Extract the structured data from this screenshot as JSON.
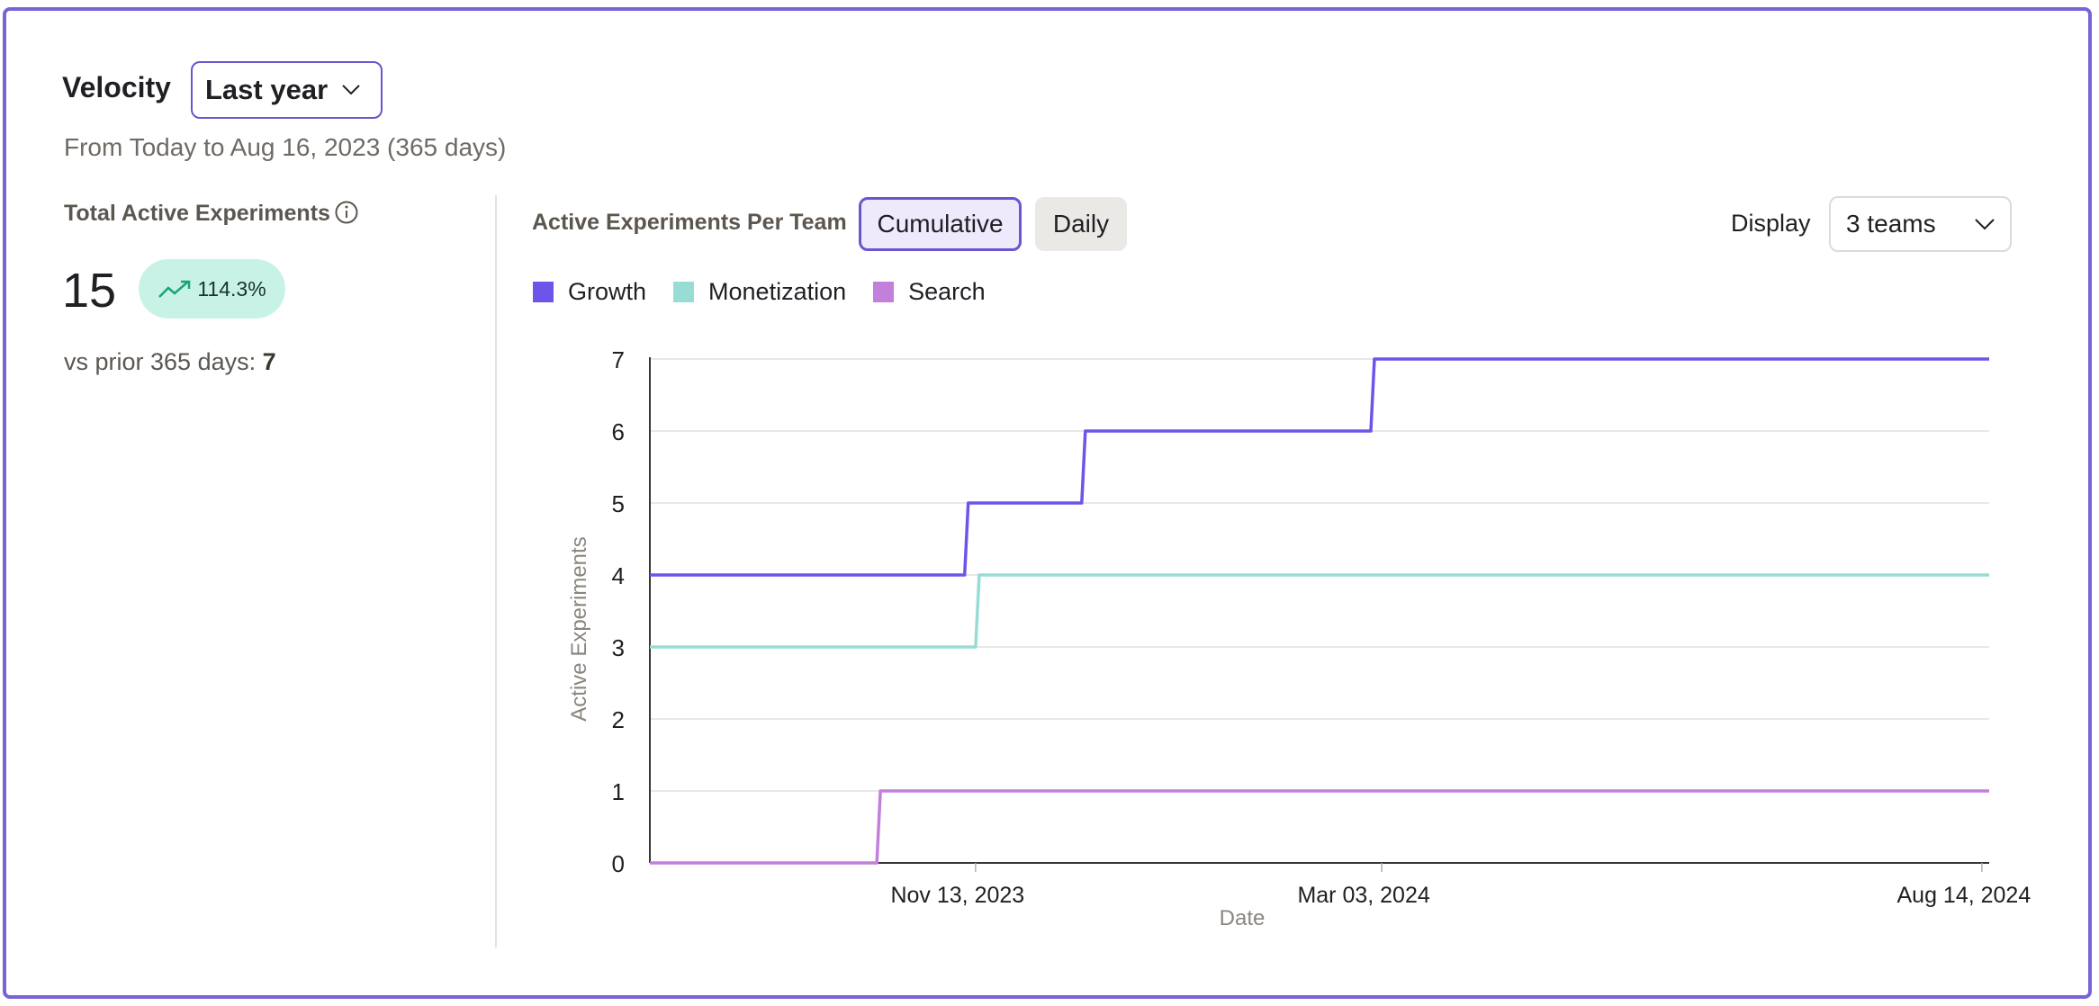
{
  "header": {
    "title": "Velocity",
    "range_select_value": "Last year",
    "range_subtitle": "From Today to Aug 16, 2023 (365 days)"
  },
  "summary": {
    "title": "Total Active Experiments",
    "value": "15",
    "delta": "114.3%",
    "vs_prior_label": "vs prior 365 days:",
    "vs_prior_value": "7"
  },
  "chart_panel": {
    "title": "Active Experiments Per Team",
    "toggle": [
      "Cumulative",
      "Daily"
    ],
    "toggle_selected": "Cumulative",
    "display_label": "Display",
    "display_value": "3 teams"
  },
  "colors": {
    "accent": "#6b55cf",
    "growth": "#6c55e8",
    "monetization": "#97ddd5",
    "search": "#c27fdc",
    "badge_bg": "#c9f2e6",
    "badge_icon": "#1aa37a"
  },
  "icons": {
    "range_chevron": "chevron-down-icon",
    "info": "info-icon",
    "trend": "trending-up-icon",
    "teams_chevron": "chevron-down-icon"
  },
  "chart_data": {
    "type": "line",
    "step": true,
    "xlabel": "Date",
    "ylabel": "Active Experiments",
    "ylim": [
      0,
      7
    ],
    "xlim": [
      "2023-08-16",
      "2024-08-16"
    ],
    "yticks": [
      0,
      1,
      2,
      3,
      4,
      5,
      6,
      7
    ],
    "xticks": [
      {
        "label": "Nov 13, 2023",
        "date": "2023-11-13"
      },
      {
        "label": "Mar 03, 2024",
        "date": "2024-03-03"
      },
      {
        "label": "Aug 14, 2024",
        "date": "2024-08-14"
      }
    ],
    "grid": true,
    "legend_position": "top-left",
    "series": [
      {
        "name": "Growth",
        "color": "#6c55e8",
        "points": [
          [
            "2023-08-16",
            4
          ],
          [
            "2023-11-11",
            5
          ],
          [
            "2023-12-13",
            6
          ],
          [
            "2024-03-01",
            7
          ],
          [
            "2024-08-16",
            7
          ]
        ]
      },
      {
        "name": "Monetization",
        "color": "#97ddd5",
        "points": [
          [
            "2023-08-16",
            3
          ],
          [
            "2023-11-14",
            4
          ],
          [
            "2024-08-16",
            4
          ]
        ]
      },
      {
        "name": "Search",
        "color": "#c27fdc",
        "points": [
          [
            "2023-08-16",
            0
          ],
          [
            "2023-10-18",
            1
          ],
          [
            "2024-08-16",
            1
          ]
        ]
      }
    ]
  }
}
